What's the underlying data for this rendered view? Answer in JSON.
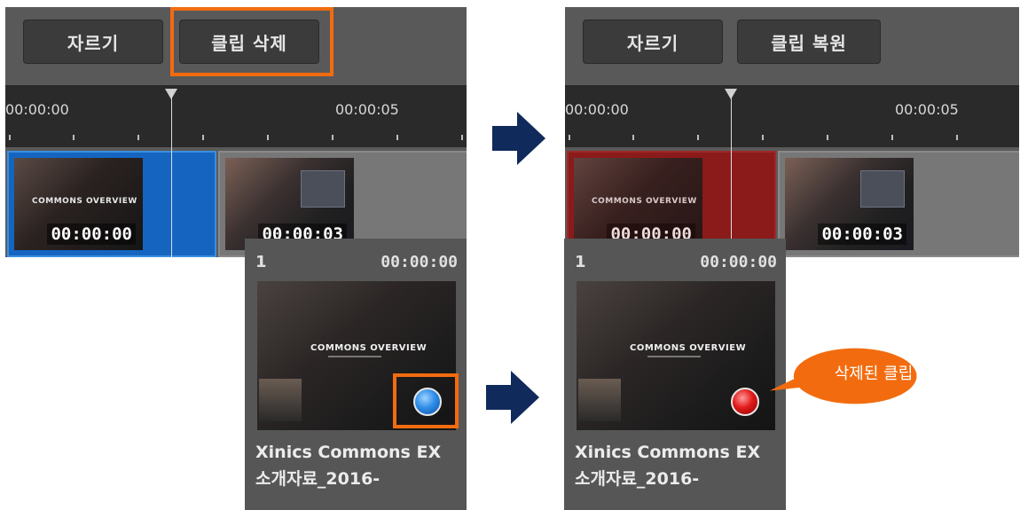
{
  "left": {
    "toolbar": {
      "cut_label": "자르기",
      "delete_label": "클립 삭제"
    },
    "ruler": {
      "tc_start": "00:00:00",
      "tc_mid": "00:00:05"
    },
    "clips": [
      {
        "timecode": "00:00:00",
        "title": "COMMONS OVERVIEW"
      },
      {
        "timecode": "00:00:03"
      }
    ],
    "card": {
      "index": "1",
      "timecode": "00:00:00",
      "thumb_title": "COMMONS OVERVIEW",
      "name_line1": "Xinics Commons EX",
      "name_line2": "소개자료_2016-"
    }
  },
  "right": {
    "toolbar": {
      "cut_label": "자르기",
      "restore_label": "클립 복원"
    },
    "ruler": {
      "tc_start": "00:00:00",
      "tc_mid": "00:00:05"
    },
    "clips": [
      {
        "timecode": "00:00:00",
        "title": "COMMONS OVERVIEW"
      },
      {
        "timecode": "00:00:03"
      }
    ],
    "card": {
      "index": "1",
      "timecode": "00:00:00",
      "thumb_title": "COMMONS OVERVIEW",
      "name_line1": "Xinics Commons EX",
      "name_line2": "소개자료_2016-"
    }
  },
  "callout": {
    "text": "삭제된 클립"
  },
  "colors": {
    "highlight": "#f26c0f",
    "selected_clip": "#1565c0",
    "deleted_clip": "#8b1a1a",
    "arrow": "#102a5c"
  },
  "icons": {
    "status_active": "blue-dot-icon",
    "status_deleted": "red-dot-icon",
    "transition": "right-arrow-icon"
  }
}
